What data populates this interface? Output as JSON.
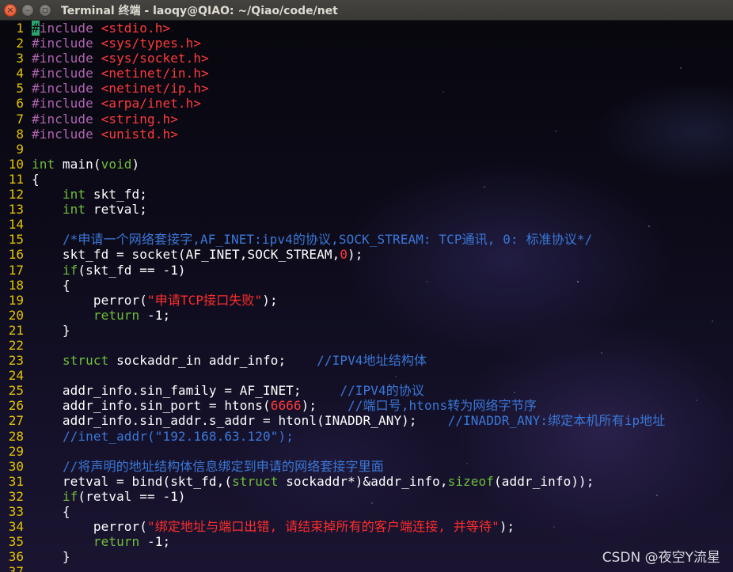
{
  "window": {
    "title": "Terminal 终端 - laoqy@QIAO: ~/Qiao/code/net",
    "buttons": {
      "close": "×",
      "minimize": "–",
      "maximize": "▫"
    }
  },
  "editor": {
    "lines": [
      [
        {
          "t": "#include ",
          "c": "pp"
        },
        {
          "t": "<stdio.h>",
          "c": "inc"
        }
      ],
      [
        {
          "t": "#include ",
          "c": "pp"
        },
        {
          "t": "<sys/types.h>",
          "c": "inc"
        }
      ],
      [
        {
          "t": "#include ",
          "c": "pp"
        },
        {
          "t": "<sys/socket.h>",
          "c": "inc"
        }
      ],
      [
        {
          "t": "#include ",
          "c": "pp"
        },
        {
          "t": "<netinet/in.h>",
          "c": "inc"
        }
      ],
      [
        {
          "t": "#include ",
          "c": "pp"
        },
        {
          "t": "<netinet/ip.h>",
          "c": "inc"
        }
      ],
      [
        {
          "t": "#include ",
          "c": "pp"
        },
        {
          "t": "<arpa/inet.h>",
          "c": "inc"
        }
      ],
      [
        {
          "t": "#include ",
          "c": "pp"
        },
        {
          "t": "<string.h>",
          "c": "inc"
        }
      ],
      [
        {
          "t": "#include ",
          "c": "pp"
        },
        {
          "t": "<unistd.h>",
          "c": "inc"
        }
      ],
      [],
      [
        {
          "t": "int",
          "c": "kw"
        },
        {
          "t": " main(",
          "c": ""
        },
        {
          "t": "void",
          "c": "kw"
        },
        {
          "t": ")",
          "c": ""
        }
      ],
      [
        {
          "t": "{",
          "c": ""
        }
      ],
      [
        {
          "t": "    ",
          "c": ""
        },
        {
          "t": "int",
          "c": "kw"
        },
        {
          "t": " skt_fd;",
          "c": ""
        }
      ],
      [
        {
          "t": "    ",
          "c": ""
        },
        {
          "t": "int",
          "c": "kw"
        },
        {
          "t": " retval;",
          "c": ""
        }
      ],
      [],
      [
        {
          "t": "    ",
          "c": ""
        },
        {
          "t": "/*申请一个网络套接字,AF_INET:ipv4的协议,SOCK_STREAM: TCP通讯, 0: 标准协议*/",
          "c": "cmt"
        }
      ],
      [
        {
          "t": "    skt_fd = socket(AF_INET,SOCK_STREAM,",
          "c": ""
        },
        {
          "t": "0",
          "c": "num"
        },
        {
          "t": ");",
          "c": ""
        }
      ],
      [
        {
          "t": "    ",
          "c": ""
        },
        {
          "t": "if",
          "c": "kw"
        },
        {
          "t": "(skt_fd == -1)",
          "c": ""
        }
      ],
      [
        {
          "t": "    {",
          "c": ""
        }
      ],
      [
        {
          "t": "        perror(",
          "c": ""
        },
        {
          "t": "\"申请TCP接口失败\"",
          "c": "str"
        },
        {
          "t": ");",
          "c": ""
        }
      ],
      [
        {
          "t": "        ",
          "c": ""
        },
        {
          "t": "return",
          "c": "kw"
        },
        {
          "t": " -1;",
          "c": ""
        }
      ],
      [
        {
          "t": "    }",
          "c": ""
        }
      ],
      [],
      [
        {
          "t": "    ",
          "c": ""
        },
        {
          "t": "struct",
          "c": "kw"
        },
        {
          "t": " sockaddr_in addr_info;    ",
          "c": ""
        },
        {
          "t": "//IPV4地址结构体",
          "c": "cmt"
        }
      ],
      [],
      [
        {
          "t": "    addr_info.sin_family = AF_INET;     ",
          "c": ""
        },
        {
          "t": "//IPV4的协议",
          "c": "cmt"
        }
      ],
      [
        {
          "t": "    addr_info.sin_port = htons(",
          "c": ""
        },
        {
          "t": "6666",
          "c": "num"
        },
        {
          "t": ");    ",
          "c": ""
        },
        {
          "t": "//端口号,htons转为网络字节序",
          "c": "cmt"
        }
      ],
      [
        {
          "t": "    addr_info.sin_addr.s_addr = htonl(INADDR_ANY);    ",
          "c": ""
        },
        {
          "t": "//INADDR_ANY:绑定本机所有ip地址",
          "c": "cmt"
        }
      ],
      [
        {
          "t": "    ",
          "c": ""
        },
        {
          "t": "//inet_addr(\"192.168.63.120\");",
          "c": "cmt"
        }
      ],
      [],
      [
        {
          "t": "    ",
          "c": ""
        },
        {
          "t": "//将声明的地址结构体信息绑定到申请的网络套接字里面",
          "c": "cmt"
        }
      ],
      [
        {
          "t": "    retval = bind(skt_fd,(",
          "c": ""
        },
        {
          "t": "struct",
          "c": "kw"
        },
        {
          "t": " sockaddr*)&addr_info,",
          "c": ""
        },
        {
          "t": "sizeof",
          "c": "kw"
        },
        {
          "t": "(addr_info));",
          "c": ""
        }
      ],
      [
        {
          "t": "    ",
          "c": ""
        },
        {
          "t": "if",
          "c": "kw"
        },
        {
          "t": "(retval == -1)",
          "c": ""
        }
      ],
      [
        {
          "t": "    {",
          "c": ""
        }
      ],
      [
        {
          "t": "        perror(",
          "c": ""
        },
        {
          "t": "\"绑定地址与端口出错, 请结束掉所有的客户端连接, 并等待\"",
          "c": "str"
        },
        {
          "t": ");",
          "c": ""
        }
      ],
      [
        {
          "t": "        ",
          "c": ""
        },
        {
          "t": "return",
          "c": "kw"
        },
        {
          "t": " -1;",
          "c": ""
        }
      ],
      [
        {
          "t": "    }",
          "c": ""
        }
      ],
      []
    ],
    "cursor_line": 1
  },
  "watermark": "CSDN @夜空Y流星",
  "colors": {
    "line_number": "#e3c400",
    "preprocessor": "#b064b0",
    "include_path": "#ff3b3b",
    "keyword": "#6fbf3a",
    "string": "#ff2d2d",
    "comment": "#3a78d8",
    "cursor": "#2aa36c"
  }
}
